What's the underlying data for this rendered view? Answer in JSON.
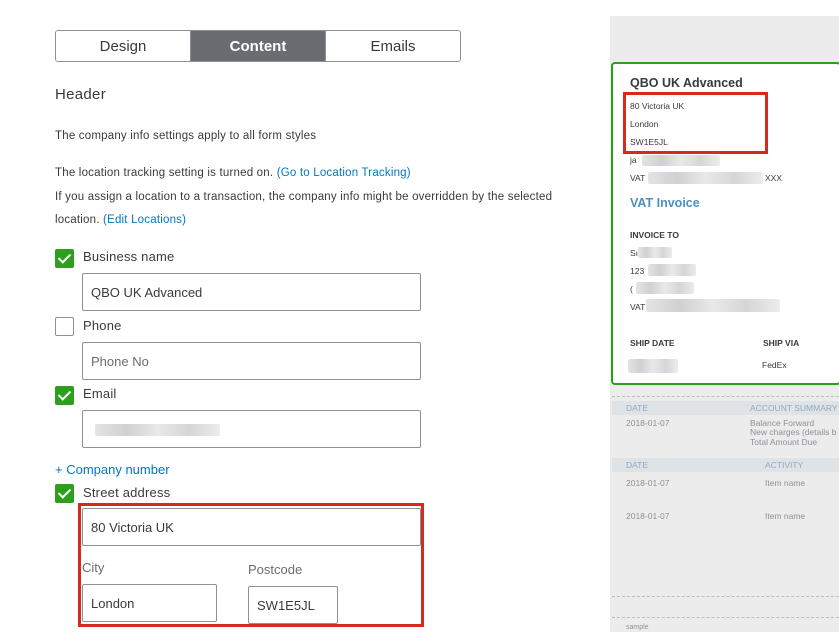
{
  "tabs": [
    {
      "label": "Design"
    },
    {
      "label": "Content"
    },
    {
      "label": "Emails"
    }
  ],
  "header": {
    "title": "Header",
    "company_info_note": "The company info settings apply to all form styles",
    "location_note": "The location tracking setting is turned on.",
    "location_link": "(Go to Location Tracking)",
    "override_note": "If you assign a location to a transaction, the company info might be overridden by the selected",
    "override_note_2": "location.",
    "edit_locations_link": "(Edit Locations)"
  },
  "fields": {
    "business_name": {
      "label": "Business name",
      "checked": true,
      "value": "QBO UK Advanced"
    },
    "phone": {
      "label": "Phone",
      "checked": false,
      "placeholder": "Phone No"
    },
    "email": {
      "label": "Email",
      "checked": true
    },
    "company_number_link": "+ Company number",
    "street_address": {
      "label": "Street address",
      "checked": true,
      "value": "80 Victoria UK"
    },
    "city": {
      "label": "City",
      "value": "London"
    },
    "postcode": {
      "label": "Postcode",
      "value": "SW1E5JL"
    }
  },
  "preview": {
    "company_name": "QBO UK Advanced",
    "address_line1": "80 Victoria UK",
    "address_line2": "London",
    "address_line3": "SW1E5JL",
    "email_prefix": "ja",
    "vat_prefix": "VAT",
    "vat_suffix": "XXX",
    "doc_title": "VAT Invoice",
    "invoice_to_label": "INVOICE TO",
    "invoice_to_line1": "Sı",
    "invoice_to_line2": "123",
    "invoice_to_line3": "(",
    "invoice_to_vat": "VAT",
    "ship_date_label": "SHIP DATE",
    "ship_via_label": "SHIP VIA",
    "ship_via_value": "FedEx",
    "summary_header": {
      "date": "DATE",
      "col": "ACCOUNT SUMMARY"
    },
    "summary_row": {
      "date": "2018-01-07",
      "line1": "Balance Forward",
      "line2": "New charges (details b",
      "line3": "Total Amount Due"
    },
    "activity_header": {
      "date": "DATE",
      "col": "ACTIVITY"
    },
    "activity_rows": [
      {
        "date": "2018-01-07",
        "item": "Item name"
      },
      {
        "date": "2018-01-07",
        "item": "Item name"
      }
    ],
    "footer_text": "sample"
  },
  "colors": {
    "accent_green": "#2ca01c",
    "link_blue": "#0077c5",
    "highlight_red": "#d52b1e",
    "active_tab": "#6b6c72"
  }
}
